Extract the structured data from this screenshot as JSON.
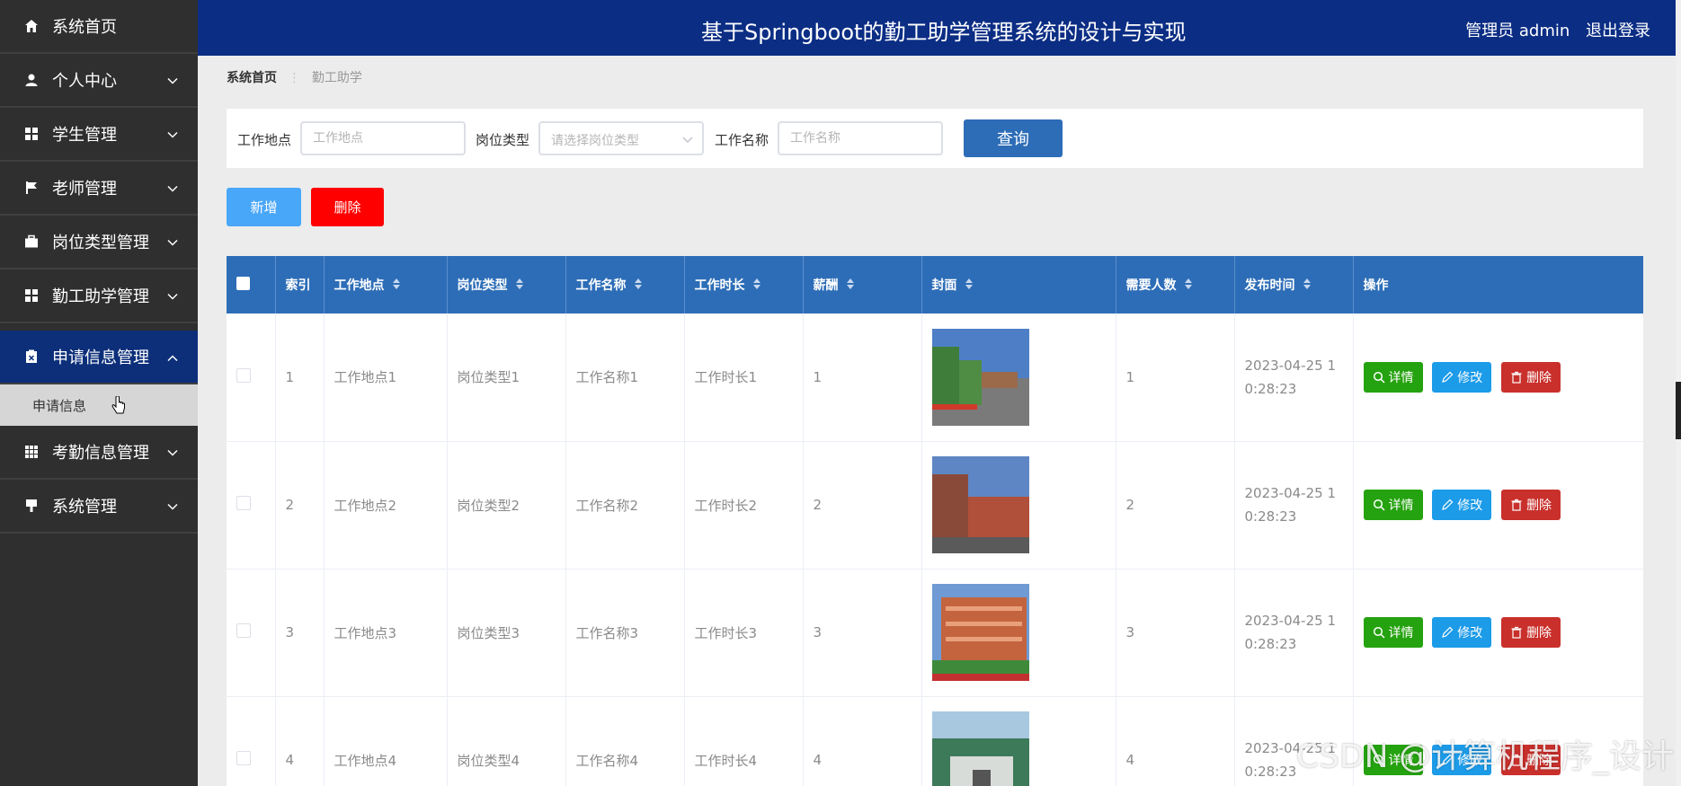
{
  "header": {
    "title": "基于Springboot的勤工助学管理系统的设计与实现",
    "user": "管理员 admin",
    "logout": "退出登录"
  },
  "sidebar": {
    "items": [
      {
        "label": "系统首页",
        "icon": "home-icon"
      },
      {
        "label": "个人中心",
        "icon": "user-icon"
      },
      {
        "label": "学生管理",
        "icon": "grid-icon"
      },
      {
        "label": "老师管理",
        "icon": "flag-icon"
      },
      {
        "label": "岗位类型管理",
        "icon": "briefcase-icon"
      },
      {
        "label": "勤工助学管理",
        "icon": "grid-icon"
      },
      {
        "label": "申请信息管理",
        "icon": "clipboard-icon"
      },
      {
        "label": "考勤信息管理",
        "icon": "table-icon"
      },
      {
        "label": "系统管理",
        "icon": "pin-icon"
      }
    ],
    "submenu": {
      "label": "申请信息"
    }
  },
  "breadcrumb": {
    "home": "系统首页",
    "current": "勤工助学"
  },
  "search": {
    "location_label": "工作地点",
    "location_placeholder": "工作地点",
    "type_label": "岗位类型",
    "type_placeholder": "请选择岗位类型",
    "name_label": "工作名称",
    "name_placeholder": "工作名称",
    "query_button": "查询"
  },
  "actions": {
    "add": "新增",
    "delete": "删除"
  },
  "table": {
    "headers": [
      "索引",
      "工作地点",
      "岗位类型",
      "工作名称",
      "工作时长",
      "薪酬",
      "封面",
      "需要人数",
      "发布时间",
      "操作"
    ],
    "rows": [
      {
        "index": "1",
        "location": "工作地点1",
        "type": "岗位类型1",
        "name": "工作名称1",
        "duration": "工作时长1",
        "salary": "1",
        "people": "1",
        "time1": "2023-04-25 1",
        "time2": "0:28:23"
      },
      {
        "index": "2",
        "location": "工作地点2",
        "type": "岗位类型2",
        "name": "工作名称2",
        "duration": "工作时长2",
        "salary": "2",
        "people": "2",
        "time1": "2023-04-25 1",
        "time2": "0:28:23"
      },
      {
        "index": "3",
        "location": "工作地点3",
        "type": "岗位类型3",
        "name": "工作名称3",
        "duration": "工作时长3",
        "salary": "3",
        "people": "3",
        "time1": "2023-04-25 1",
        "time2": "0:28:23"
      },
      {
        "index": "4",
        "location": "工作地点4",
        "type": "岗位类型4",
        "name": "工作名称4",
        "duration": "工作时长4",
        "salary": "4",
        "people": "4",
        "time1": "2023-04-25 1",
        "time2": "0:28:23"
      }
    ],
    "ops": {
      "detail": "详情",
      "edit": "修改",
      "delete": "删除"
    }
  },
  "watermark": "CSDN @计算机程序_设计",
  "colors": {
    "header": "#0b2d84",
    "sidebar": "#2f2f2f",
    "table_head": "#2d6db7",
    "detail": "#25a20f",
    "edit": "#1c9be8",
    "delete": "#c9302c"
  }
}
